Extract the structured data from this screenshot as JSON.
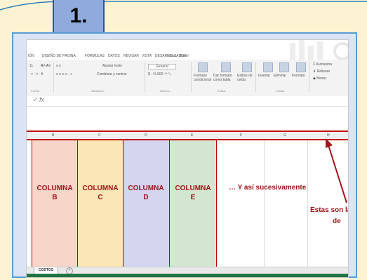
{
  "slide": {
    "step_label": "1."
  },
  "excel": {
    "window_title": "Libro1 - Excel",
    "tabs": [
      "IÓN",
      "DISEÑO DE PÁGINA",
      "FÓRMULAS",
      "DATOS",
      "REVISAR",
      "VISTA",
      "DESARROLLADOR"
    ],
    "ribbon": {
      "font_size": "11",
      "wrap_text": "Ajustar texto",
      "merge_center": "Combinar y centrar",
      "number_format": "General",
      "cond_format": "Formato condicional",
      "format_table": "Dar formato como tabla",
      "cell_styles": "Estilos de celda",
      "insert": "Insertar",
      "delete": "Eliminar",
      "format": "Formato",
      "autosum": "Autosuma",
      "fill": "Rellenar",
      "clear": "Borrar",
      "groups": [
        "Fuente",
        "Alineación",
        "Número",
        "Estilos",
        "Celdas"
      ]
    },
    "formula_bar": {
      "fx": "fx"
    },
    "column_headers": [
      "B",
      "C",
      "D",
      "E",
      "F",
      "G",
      "H"
    ],
    "columns": [
      {
        "line1": "COLUMNA",
        "line2": "B"
      },
      {
        "line1": "COLUMNA",
        "line2": "C"
      },
      {
        "line1": "COLUMNA",
        "line2": "D"
      },
      {
        "line1": "COLUMNA",
        "line2": "E"
      }
    ],
    "etc_text": "… Y así sucesivamente",
    "note_line1": "Estas son la",
    "note_line2": "de",
    "sheet_tab": "COSTOS",
    "colors": {
      "accent_red": "#c00000",
      "col_b": "#f8d5c9",
      "col_c": "#fbe6b5",
      "col_d": "#d3d5ee",
      "col_e": "#d4e6cf",
      "status_green": "#217346"
    }
  }
}
